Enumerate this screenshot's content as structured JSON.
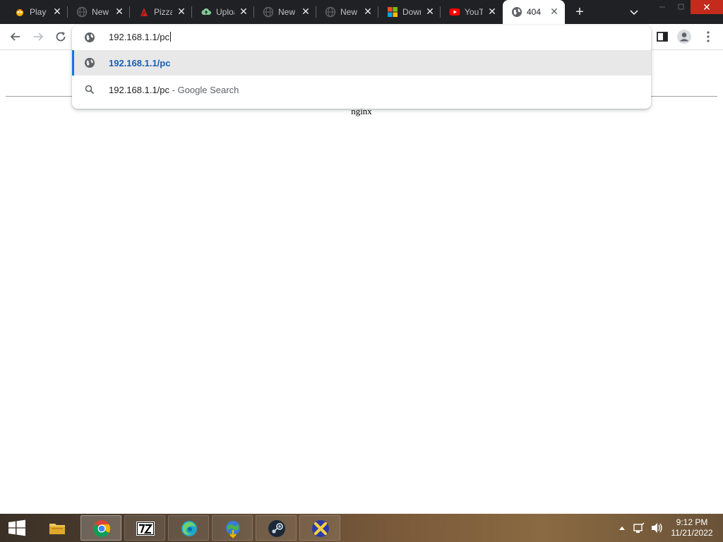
{
  "tabs": [
    {
      "title": "Play",
      "icon": "game-icon"
    },
    {
      "title": "New",
      "icon": "globe-icon"
    },
    {
      "title": "Pizza",
      "icon": "pizza-icon"
    },
    {
      "title": "Upload",
      "icon": "cloud-upload-icon"
    },
    {
      "title": "New",
      "icon": "globe-icon"
    },
    {
      "title": "New",
      "icon": "globe-icon"
    },
    {
      "title": "Download",
      "icon": "microsoft-icon"
    },
    {
      "title": "YouTube",
      "icon": "youtube-icon"
    },
    {
      "title": "404",
      "icon": "globe-icon",
      "active": true
    }
  ],
  "omnibox": {
    "input_value": "192.168.1.1/pc",
    "suggestions": [
      {
        "text": "192.168.1.1/pc",
        "icon": "globe-icon",
        "selected": true
      },
      {
        "text": "192.168.1.1/pc",
        "desc": " - Google Search",
        "icon": "search-icon"
      }
    ]
  },
  "page": {
    "server_text": "nginx"
  },
  "clock": {
    "time": "9:12 PM",
    "date": "11/21/2022"
  },
  "colors": {
    "tabstrip": "#202124",
    "accent": "#1a73e8",
    "selected_row": "#e8e8e8"
  }
}
